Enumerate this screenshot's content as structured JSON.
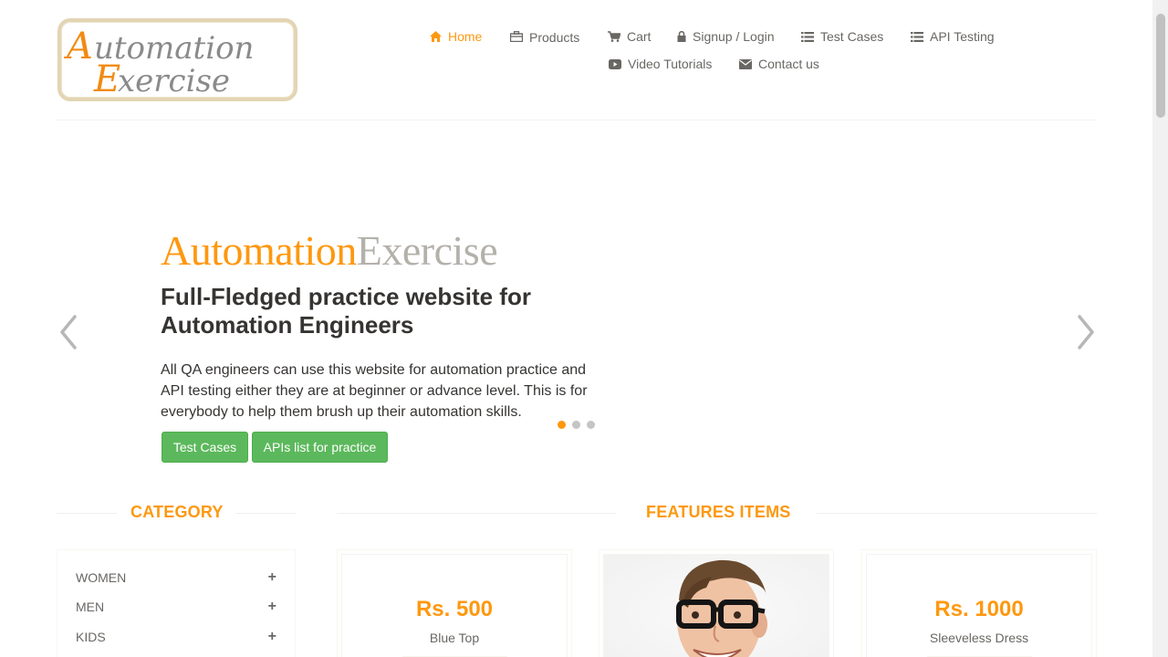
{
  "logo": {
    "line1": "Automation",
    "line2": "Exercise"
  },
  "nav": {
    "home": "Home",
    "products": "Products",
    "cart": "Cart",
    "signup": "Signup / Login",
    "test_cases": "Test Cases",
    "api_testing": "API Testing",
    "video_tutorials": "Video Tutorials",
    "contact": "Contact us"
  },
  "slider": {
    "brand_part1": "Automation",
    "brand_part2": "Exercise",
    "title": "Full-Fledged practice website for Automation Engineers",
    "text": "All QA engineers can use this website for automation practice and API testing either they are at beginner or advance level. This is for everybody to help them brush up their automation skills.",
    "btn_test_cases": "Test Cases",
    "btn_apis": "APIs list for practice",
    "active_slide": 1,
    "slide_count": 3
  },
  "category": {
    "title": "CATEGORY",
    "items": [
      {
        "label": "WOMEN",
        "icon": "plus-icon"
      },
      {
        "label": "MEN",
        "icon": "plus-icon"
      },
      {
        "label": "KIDS",
        "icon": "plus-icon"
      }
    ]
  },
  "features": {
    "title": "FEATURES ITEMS",
    "products": [
      {
        "price": "Rs. 500",
        "name": "Blue Top"
      },
      {
        "image": "man-with-glasses-photo"
      },
      {
        "price": "Rs. 1000",
        "name": "Sleeveless Dress"
      }
    ]
  },
  "colors": {
    "accent": "#fe980f",
    "button_green": "#5cb85c",
    "text_dark": "#363432"
  }
}
